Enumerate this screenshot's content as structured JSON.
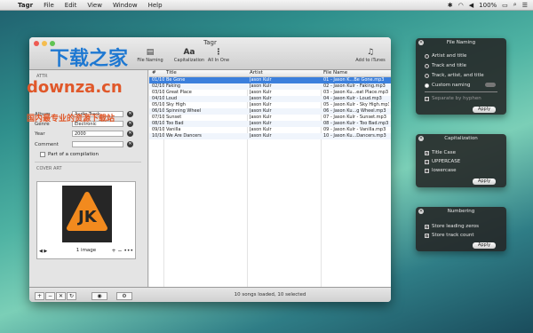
{
  "menubar": {
    "app": "Tagr",
    "items": [
      "File",
      "Edit",
      "View",
      "Window",
      "Help"
    ],
    "battery": "100%"
  },
  "watermark": {
    "line1": "下载之家",
    "line2": "downza.cn",
    "line3": "国内最专业的资源下载站"
  },
  "window": {
    "title": "Tagr",
    "toolbar": {
      "naming_label": "File Naming",
      "capitalization_label": "Capitalization",
      "allinone_label": "All In One",
      "itunes_label": "Add to iTunes",
      "aa_glyph": "Aa"
    },
    "fields": {
      "section_attr": "ATTR",
      "album": {
        "label": "Album",
        "value": "Audio Track"
      },
      "genre": {
        "label": "Genre",
        "value": "Electronic"
      },
      "year": {
        "label": "Year",
        "value": "2000"
      },
      "comment": {
        "label": "Comment",
        "value": ""
      },
      "compilation_label": "Part of a compilation",
      "cover_art_label": "COVER ART",
      "image_count": "1 image"
    },
    "table": {
      "headers": {
        "num": "#",
        "title": "Title",
        "artist": "Artist",
        "file": "File Name"
      },
      "rows": [
        {
          "num": "01/10",
          "title": "Be Gone",
          "artist": "Jason Kulr",
          "file": "01 - Jason K...Be Gone.mp3"
        },
        {
          "num": "02/10",
          "title": "Faking",
          "artist": "Jason Kulr",
          "file": "02 - Jason Kulr - Faking.mp3"
        },
        {
          "num": "03/10",
          "title": "Great Place",
          "artist": "Jason Kulr",
          "file": "03 - Jason Ku...eat Place.mp3"
        },
        {
          "num": "04/10",
          "title": "Loud",
          "artist": "Jason Kulr",
          "file": "04 - Jason Kulr - Loud.mp3"
        },
        {
          "num": "05/10",
          "title": "Sky High",
          "artist": "Jason Kulr",
          "file": "05 - Jason Kulr - Sky High.mp3"
        },
        {
          "num": "06/10",
          "title": "Spinning Wheel",
          "artist": "Jason Kulr",
          "file": "06 - Jason Ku...g Wheel.mp3"
        },
        {
          "num": "07/10",
          "title": "Sunset",
          "artist": "Jason Kulr",
          "file": "07 - Jason Kulr - Sunset.mp3"
        },
        {
          "num": "08/10",
          "title": "Too Bad",
          "artist": "Jason Kulr",
          "file": "08 - Jason Kulr - Too Bad.mp3"
        },
        {
          "num": "09/10",
          "title": "Vanilla",
          "artist": "Jason Kulr",
          "file": "09 - Jason Kulr - Vanilla.mp3"
        },
        {
          "num": "10/10",
          "title": "We Are Dancers",
          "artist": "Jason Kulr",
          "file": "10 - Jason Ku...Dancers.mp3"
        }
      ]
    },
    "status": "10 songs loaded, 10 selected"
  },
  "panels": {
    "file_naming": {
      "title": "File Naming",
      "options": [
        "Artist and title",
        "Track and title",
        "Track, artist, and title",
        "Custom naming"
      ],
      "separator_label": "Separate by hyphen",
      "apply": "Apply"
    },
    "capitalization": {
      "title": "Capitalization",
      "options": [
        "Title Case",
        "UPPERCASE",
        "lowercase"
      ],
      "apply": "Apply"
    },
    "numbering": {
      "title": "Numbering",
      "options": [
        "Store leading zeros",
        "Store track count"
      ],
      "apply": "Apply"
    }
  }
}
